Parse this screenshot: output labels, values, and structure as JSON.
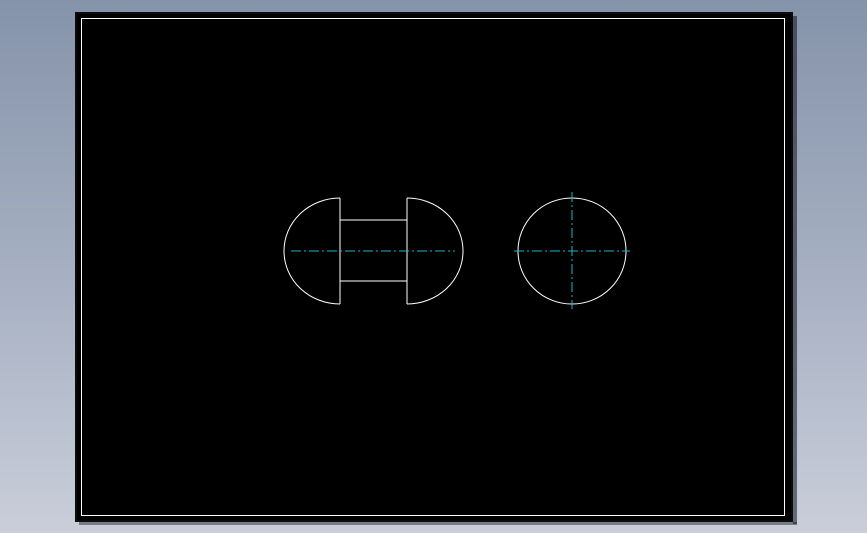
{
  "viewport": {
    "background_top": "#8593aa",
    "background_bottom": "#c9ced9"
  },
  "sheet": {
    "background": "#000000",
    "frame_color": "#ffffff"
  },
  "drawing": {
    "outline_color": "#ffffff",
    "centerline_color": "#1ab3c8",
    "views": [
      {
        "name": "front-view",
        "shape": "shaft-with-domed-heads"
      },
      {
        "name": "side-view",
        "shape": "circle"
      }
    ]
  }
}
